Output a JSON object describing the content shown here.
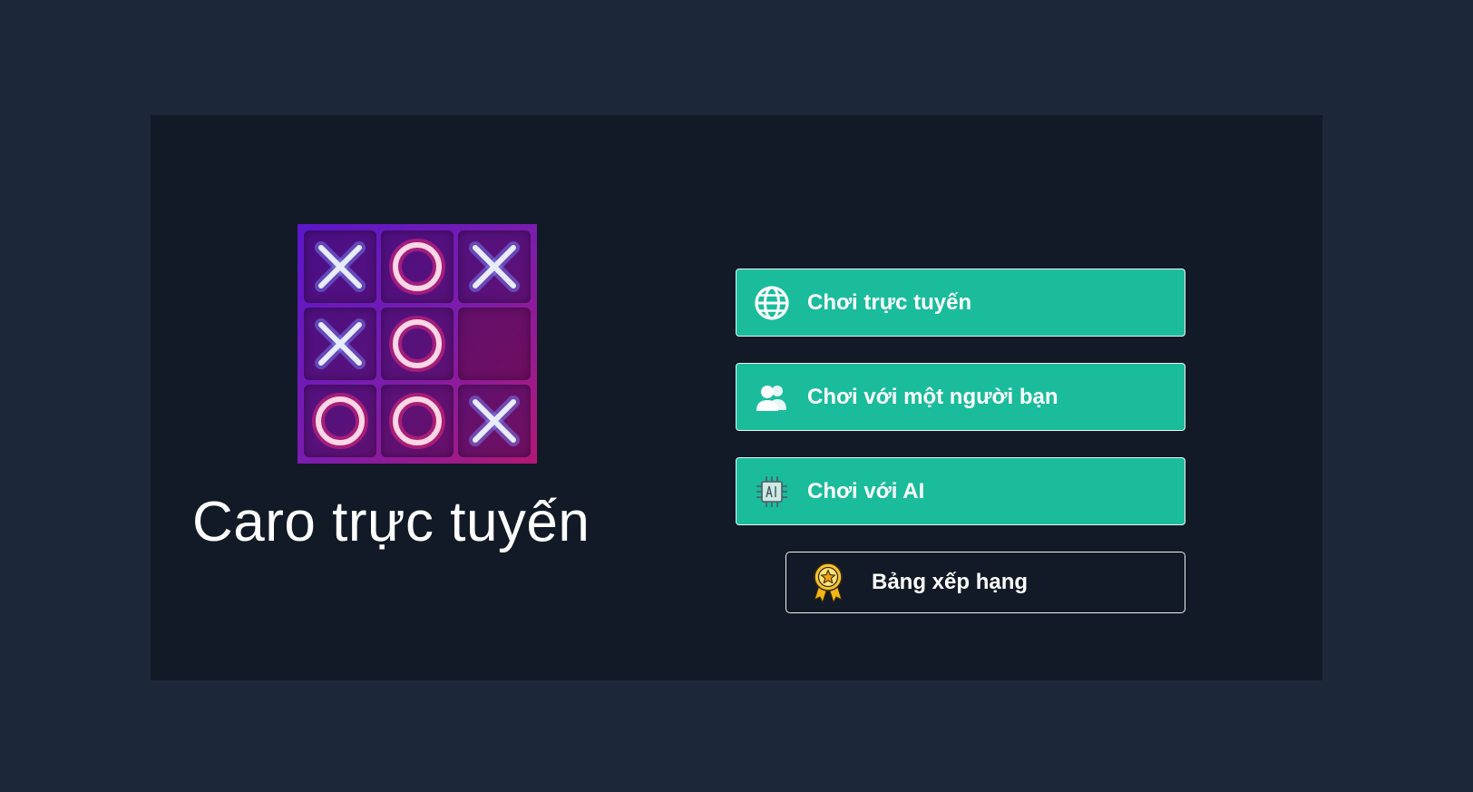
{
  "app": {
    "title": "Caro trực tuyến"
  },
  "logo": {
    "board": [
      "X",
      "O",
      "X",
      "X",
      "O",
      "",
      "O",
      "O",
      "X"
    ],
    "colors": {
      "x_glow": "#7d8cff",
      "o_glow": "#ff2e7e",
      "frame": "#6a1ad0"
    }
  },
  "menu": {
    "online": {
      "label": "Chơi trực tuyến",
      "icon": "globe-icon"
    },
    "friend": {
      "label": "Chơi với một người bạn",
      "icon": "users-icon"
    },
    "ai": {
      "label": "Chơi với AI",
      "icon": "ai-chip-icon"
    },
    "leaderboard": {
      "label": "Bảng xếp hạng",
      "icon": "medal-icon"
    }
  },
  "theme": {
    "background": "#1c2739",
    "panel": "#111a26",
    "accent": "#1abc9c"
  }
}
